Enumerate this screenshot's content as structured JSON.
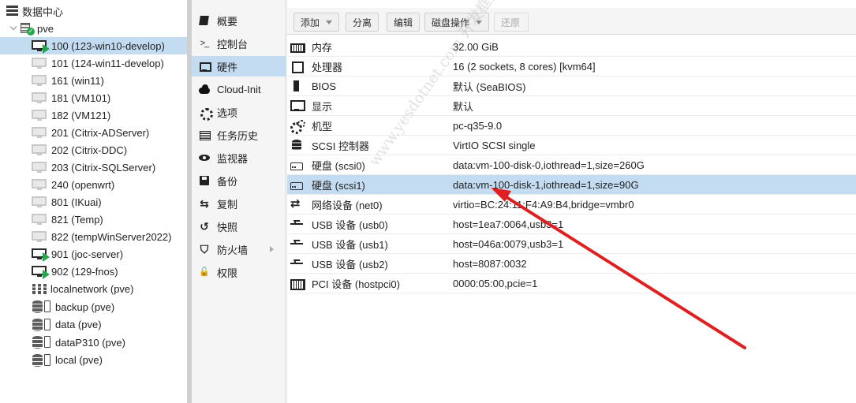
{
  "tree": {
    "datacenter": "数据中心",
    "node": "pve",
    "vms": [
      {
        "label": "100 (123-win10-develop)",
        "running": true,
        "selected": true
      },
      {
        "label": "101 (124-win11-develop)",
        "running": false
      },
      {
        "label": "161 (win11)",
        "running": false
      },
      {
        "label": "181 (VM101)",
        "running": false
      },
      {
        "label": "182 (VM121)",
        "running": false
      },
      {
        "label": "201 (Citrix-ADServer)",
        "running": false
      },
      {
        "label": "202 (Citrix-DDC)",
        "running": false
      },
      {
        "label": "203 (Citrix-SQLServer)",
        "running": false
      },
      {
        "label": "240 (openwrt)",
        "running": false
      },
      {
        "label": "801 (IKuai)",
        "running": false
      },
      {
        "label": "821 (Temp)",
        "running": false
      },
      {
        "label": "822 (tempWinServer2022)",
        "running": false
      },
      {
        "label": "901 (joc-server)",
        "running": true
      },
      {
        "label": "902 (129-fnos)",
        "running": true
      }
    ],
    "sdn": "localnetwork (pve)",
    "storages": [
      "backup (pve)",
      "data (pve)",
      "dataP310 (pve)",
      "local (pve)"
    ]
  },
  "subnav": {
    "items": [
      {
        "label": "概要",
        "icon": "book-icon"
      },
      {
        "label": "控制台",
        "icon": "terminal-icon"
      },
      {
        "label": "硬件",
        "icon": "monitor-icon",
        "selected": true
      },
      {
        "label": "Cloud-Init",
        "icon": "cloud-icon"
      },
      {
        "label": "选项",
        "icon": "gear-icon"
      },
      {
        "label": "任务历史",
        "icon": "list-icon"
      },
      {
        "label": "监视器",
        "icon": "eye-icon"
      },
      {
        "label": "备份",
        "icon": "floppy-icon"
      },
      {
        "label": "复制",
        "icon": "retweet-icon"
      },
      {
        "label": "快照",
        "icon": "history-icon"
      },
      {
        "label": "防火墙",
        "icon": "shield-icon",
        "has_arrow": true
      },
      {
        "label": "权限",
        "icon": "unlock-icon"
      }
    ]
  },
  "toolbar": {
    "add": "添加",
    "remove": "分离",
    "edit": "编辑",
    "disk_action": "磁盘操作",
    "revert": "还原"
  },
  "hardware": [
    {
      "name": "内存",
      "value": "32.00 GiB",
      "icon": "memory-icon"
    },
    {
      "name": "处理器",
      "value": "16 (2 sockets, 8 cores) [kvm64]",
      "icon": "cpu-icon"
    },
    {
      "name": "BIOS",
      "value": "默认 (SeaBIOS)",
      "icon": "chip-icon"
    },
    {
      "name": "显示",
      "value": "默认",
      "icon": "display-icon"
    },
    {
      "name": "机型",
      "value": "pc-q35-9.0",
      "icon": "gears-icon"
    },
    {
      "name": "SCSI 控制器",
      "value": "VirtIO SCSI single",
      "icon": "database-icon"
    },
    {
      "name": "硬盘 (scsi0)",
      "value": "data:vm-100-disk-0,iothread=1,size=260G",
      "icon": "hdd-icon"
    },
    {
      "name": "硬盘 (scsi1)",
      "value": "data:vm-100-disk-1,iothread=1,size=90G",
      "icon": "hdd-icon",
      "selected": true
    },
    {
      "name": "网络设备 (net0)",
      "value": "virtio=BC:24:11:F4:A9:B4,bridge=vmbr0",
      "icon": "exchange-icon"
    },
    {
      "name": "USB 设备 (usb0)",
      "value": "host=1ea7:0064,usb3=1",
      "icon": "usb-icon"
    },
    {
      "name": "USB 设备 (usb1)",
      "value": "host=046a:0079,usb3=1",
      "icon": "usb-icon"
    },
    {
      "name": "USB 设备 (usb2)",
      "value": "host=8087:0032",
      "icon": "usb-icon"
    },
    {
      "name": "PCI 设备 (hostpci0)",
      "value": "0000:05:00,pcie=1",
      "icon": "pci-icon"
    }
  ],
  "watermark": "www.yesdotnet.com 开发框架",
  "colors": {
    "selection": "#c4dcf2",
    "running": "#21a94b",
    "arrow": "#e02020"
  }
}
